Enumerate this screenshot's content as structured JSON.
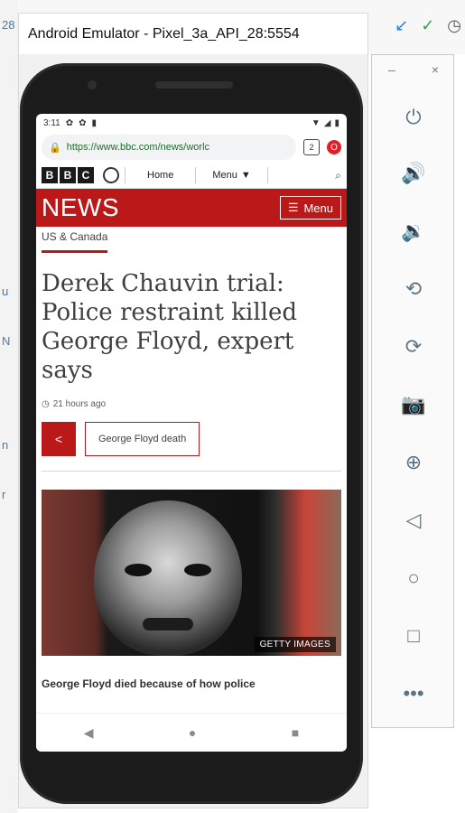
{
  "window": {
    "title": "Android Emulator - Pixel_3a_API_28:5554"
  },
  "background": {
    "left_fragments": [
      "28",
      "u",
      "N",
      "n",
      "r"
    ],
    "top_right_icons": [
      "check-blue-icon",
      "check-green-icon",
      "history-icon"
    ]
  },
  "phone": {
    "status_bar": {
      "time": "3:11",
      "left_icons": [
        "settings-icon",
        "settings-icon",
        "sim-icon"
      ],
      "right_icons": [
        "wifi-icon",
        "signal-icon",
        "battery-icon"
      ]
    },
    "browser": {
      "url": "https://www.bbc.com/news/worlc",
      "tab_count": "2"
    },
    "bbc_header": {
      "logo_letters": [
        "B",
        "B",
        "C"
      ],
      "home_label": "Home",
      "menu_label": "Menu"
    },
    "news": {
      "wordmark": "NEWS",
      "menu_button": "Menu"
    },
    "article": {
      "section": "US & Canada",
      "headline": "Derek Chauvin trial: Police restraint killed George Floyd, expert says",
      "time_ago": "21 hours ago",
      "topic": "George Floyd death",
      "image_credit": "GETTY IMAGES",
      "caption": "George Floyd died because of how police"
    },
    "nav_buttons": [
      "back-icon",
      "home-icon",
      "recents-icon"
    ]
  },
  "side_toolbar": {
    "minimize": "–",
    "close": "×",
    "buttons": [
      "power-icon",
      "volume-up-icon",
      "volume-down-icon",
      "rotate-left-icon",
      "rotate-right-icon",
      "camera-icon",
      "zoom-icon",
      "back-icon",
      "home-icon",
      "overview-icon",
      "more-icon"
    ]
  },
  "colors": {
    "bbc_red": "#bb1919",
    "emulator_icon": "#5f7482"
  }
}
